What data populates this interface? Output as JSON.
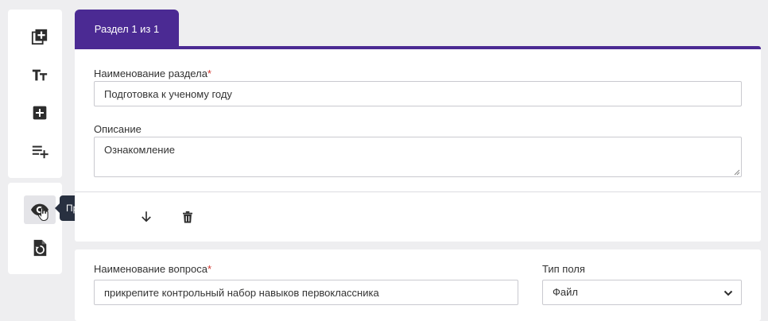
{
  "tooltip": {
    "text": "Предпросмотр"
  },
  "toolbar": {
    "top_tools": [
      {
        "icon": "add-copy-icon"
      },
      {
        "icon": "text-size-icon"
      },
      {
        "icon": "add-box-icon"
      },
      {
        "icon": "playlist-add-icon"
      }
    ],
    "bottom_tools": [
      {
        "icon": "eye-preview-icon",
        "active": true
      },
      {
        "icon": "restore-page-icon"
      }
    ]
  },
  "section": {
    "tab_label": "Раздел 1 из 1",
    "name_label": "Наименование раздела",
    "required_mark": "*",
    "name_value": "Подготовка к ученому году",
    "description_label": "Описание",
    "description_value": "Ознакомление"
  },
  "question": {
    "name_label": "Наименование вопроса",
    "required_mark": "*",
    "name_value": "прикрепите контрольный набор навыков первоклассника",
    "type_label": "Тип поля",
    "type_value": "Файл"
  },
  "colors": {
    "accent": "#4b2a93",
    "tooltip_bg": "#283040",
    "required": "#d0342c",
    "background": "#eeeef0"
  }
}
